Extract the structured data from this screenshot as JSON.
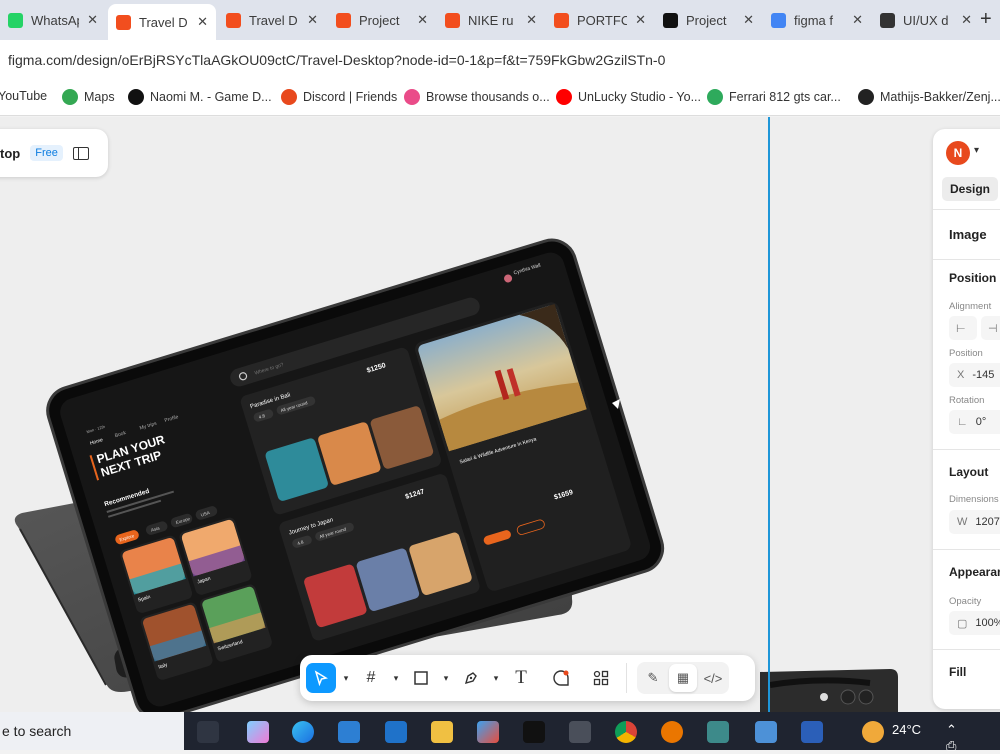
{
  "browser": {
    "tabs": [
      {
        "title": "WhatsApp",
        "icon": "whatsapp-icon",
        "color": "#25d366"
      },
      {
        "title": "Travel D",
        "icon": "figma-icon",
        "color": "#f24e1e",
        "active": true
      },
      {
        "title": "Travel D",
        "icon": "figma-icon",
        "color": "#f24e1e"
      },
      {
        "title": "Project",
        "icon": "figma-icon",
        "color": "#f24e1e"
      },
      {
        "title": "NIKE ru",
        "icon": "figma-icon",
        "color": "#f24e1e"
      },
      {
        "title": "PORTFC",
        "icon": "figma-icon",
        "color": "#f24e1e"
      },
      {
        "title": "Project",
        "icon": "upwork-icon",
        "color": "#111111"
      },
      {
        "title": "figma f",
        "icon": "google-icon",
        "color": "#4285f4"
      },
      {
        "title": "UI/UX d",
        "icon": "openai-icon",
        "color": "#333333"
      }
    ],
    "new_tab": "+",
    "url": "figma.com/design/oErBjRSYcTlaAGkOU09ctC/Travel-Desktop?node-id=0-1&p=f&t=759FkGbw2GzilSTn-0",
    "bookmarks": [
      {
        "label": "YouTube",
        "icon": "youtube-icon",
        "color": "#ff0000"
      },
      {
        "label": "Maps",
        "icon": "maps-icon",
        "color": "#34a853"
      },
      {
        "label": "Naomi M. - Game D...",
        "icon": "upwork-icon",
        "color": "#111111"
      },
      {
        "label": "Discord | Friends",
        "icon": "discord-icon",
        "color": "#e8491d"
      },
      {
        "label": "Browse thousands o...",
        "icon": "dribbble-icon",
        "color": "#ea4c89"
      },
      {
        "label": "UnLucky Studio - Yo...",
        "icon": "youtube-icon",
        "color": "#ff0000"
      },
      {
        "label": "Ferrari 812 gts car...",
        "icon": "globe-icon",
        "color": "#2eaa5c"
      },
      {
        "label": "Mathijs-Bakker/Zenj...",
        "icon": "github-icon",
        "color": "#222222"
      }
    ]
  },
  "figma": {
    "file_name": "top",
    "plan_badge": "Free",
    "right_panel": {
      "avatar_letter": "N",
      "tab": "Design",
      "section_title": "Image",
      "position_heading": "Position",
      "alignment_label": "Alignment",
      "position_label": "Position",
      "x_key": "X",
      "x_value": "-145",
      "rotation_label": "Rotation",
      "rotation_value": "0°",
      "layout_heading": "Layout",
      "dimensions_label": "Dimensions",
      "w_key": "W",
      "w_value": "1207",
      "appearance_heading": "Appearance",
      "opacity_label": "Opacity",
      "opacity_value": "100%",
      "fill_heading": "Fill"
    },
    "toolbar": {
      "tools": [
        "move-tool",
        "frame-tool",
        "rectangle-tool",
        "pen-tool",
        "text-tool",
        "comment-tool",
        "actions-tool"
      ],
      "active_tool": "move-tool"
    },
    "mockup": {
      "nav": [
        "Home",
        "Book",
        "My trips",
        "Profile"
      ],
      "headline_1": "PLAN YOUR",
      "headline_2": "NEXT TRIP",
      "recommended": "Recommended",
      "filters": [
        "Asia",
        "Europe",
        "USA"
      ],
      "cta": "Explore",
      "search_placeholder": "Where to go?",
      "user_name": "Cynthia Wall",
      "places": [
        {
          "name": "Spain"
        },
        {
          "name": "Japan"
        },
        {
          "name": "Italy"
        },
        {
          "name": "Switzerland"
        }
      ],
      "offers": [
        {
          "title": "Paradise in Bali",
          "price": "$1250",
          "rating": "4.8",
          "tag": "All year round"
        },
        {
          "title": "Journey to Japan",
          "price": "$1247",
          "rating": "4.8",
          "tag": "All year round"
        }
      ],
      "feature": {
        "title": "Safari & Wildlife Adventure in Kenya",
        "price": "$1659"
      }
    }
  },
  "taskbar": {
    "search_text": "e to search",
    "weather": "24°C"
  }
}
